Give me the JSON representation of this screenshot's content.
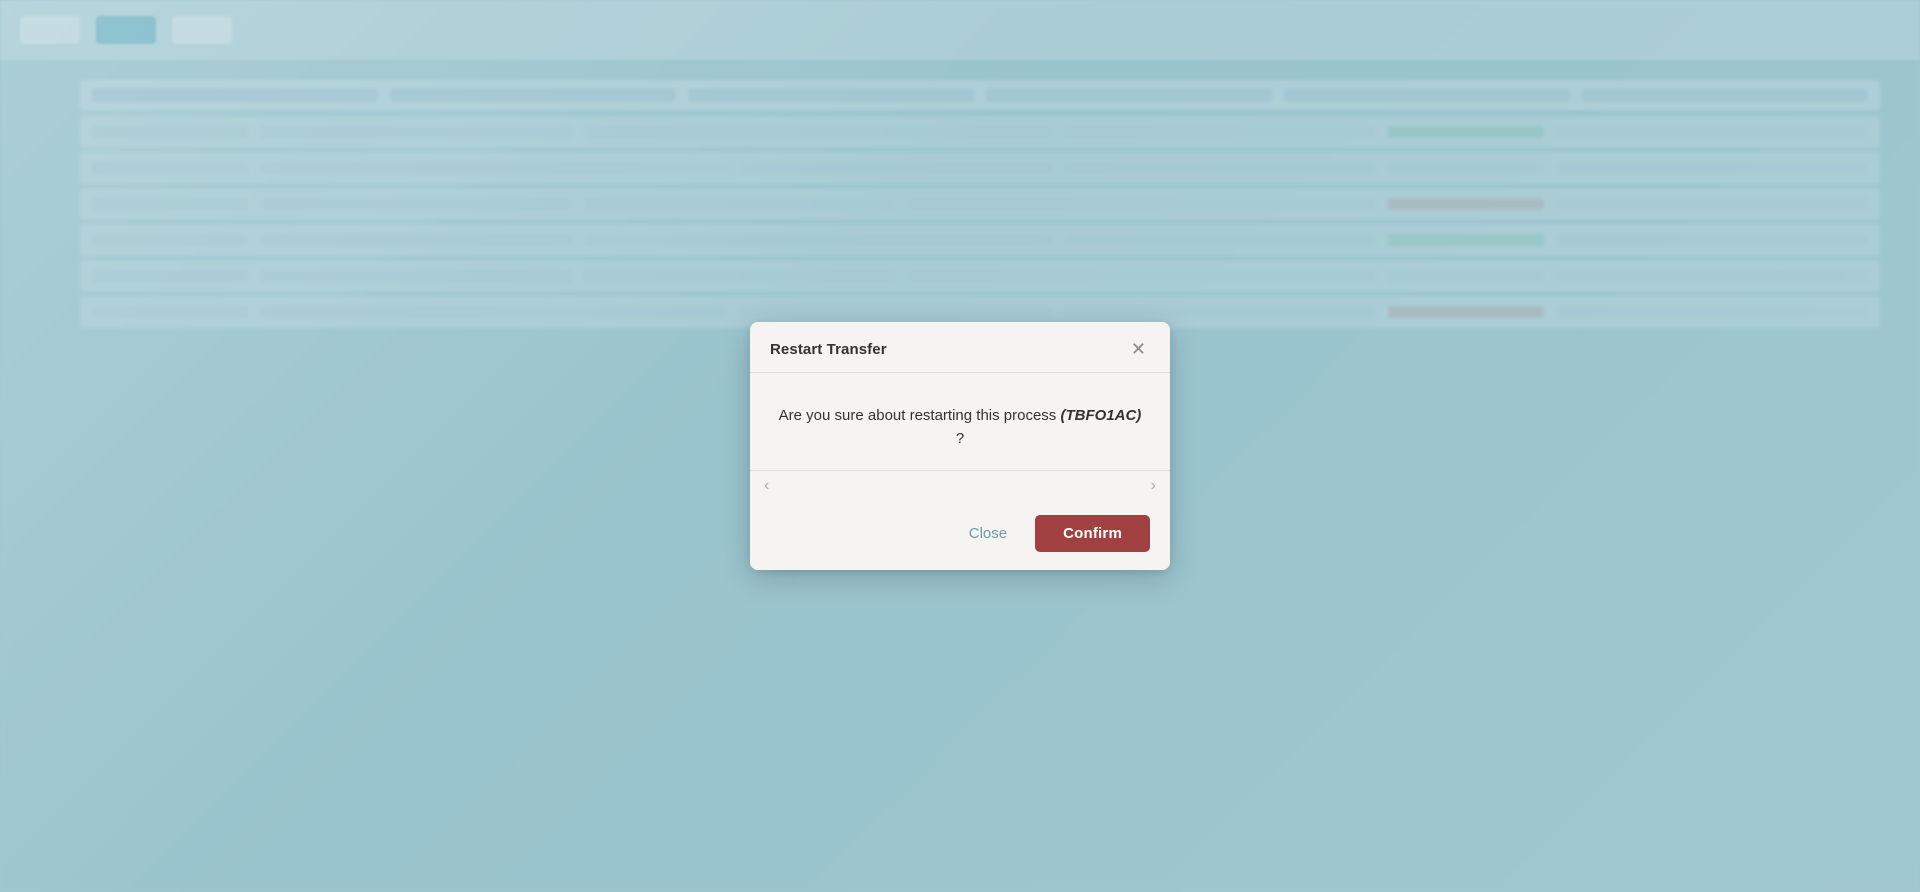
{
  "modal": {
    "title": "Restart Transfer",
    "message_prefix": "Are you sure about restarting this process",
    "process_id": "(TBFO1AC)",
    "message_suffix": "?",
    "close_button_label": "Close",
    "confirm_button_label": "Confirm"
  },
  "icons": {
    "close_x": "✕",
    "arrow_left": "‹",
    "arrow_right": "›"
  },
  "colors": {
    "confirm_bg": "#a04040",
    "close_text": "#6a9aaa",
    "modal_bg": "#f5f4f2"
  }
}
